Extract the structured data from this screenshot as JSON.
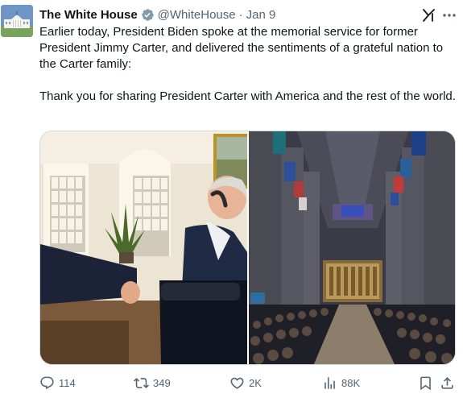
{
  "tweet": {
    "author": {
      "display_name": "The White House",
      "handle": "@WhiteHouse",
      "verified_badge": "verified-gray-badge-icon",
      "avatar": "white-house-avatar"
    },
    "separator": "·",
    "date": "Jan 9",
    "text_paragraphs": [
      "Earlier today, President Biden spoke at the memorial service for former President Jimmy Carter, and delivered the sentiments of a grateful nation to the Carter family:",
      "Thank you for sharing President Carter with America and the rest of the world."
    ],
    "media": [
      {
        "name": "photo-carter-oval-office",
        "icon": "photo"
      },
      {
        "name": "photo-cathedral-memorial-service",
        "icon": "photo"
      }
    ],
    "actions": {
      "replies": "114",
      "reposts": "349",
      "likes": "2K",
      "views": "88K"
    },
    "icons": {
      "grok": "grok-icon",
      "more": "more-icon",
      "reply": "reply-icon",
      "repost": "repost-icon",
      "like": "heart-icon",
      "views": "analytics-icon",
      "bookmark": "bookmark-icon",
      "share": "share-icon"
    }
  },
  "colors": {
    "text_primary": "#0f1419",
    "text_secondary": "#536471",
    "border": "#cfd9de",
    "badge": "#829aab"
  }
}
